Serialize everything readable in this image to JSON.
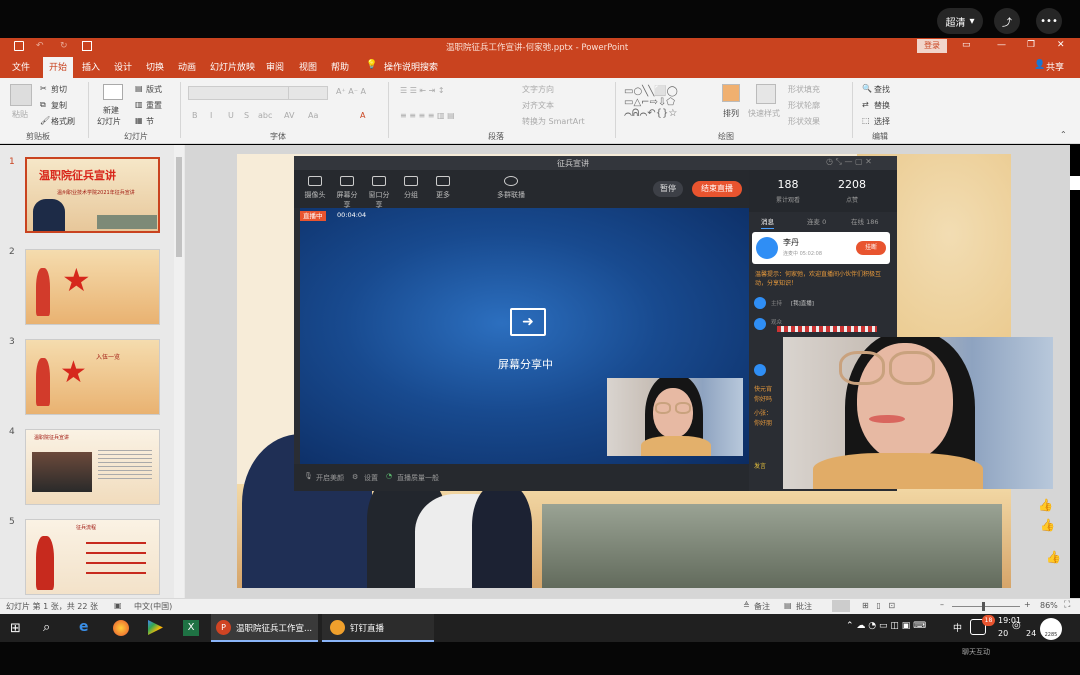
{
  "stream": {
    "quality": "超清",
    "quality_caret": "▾",
    "share": "⤴",
    "more": "•••"
  },
  "app": {
    "title": "温职院征兵工作宣讲-何家弛.pptx - PowerPoint",
    "login": "登录",
    "window_controls": [
      "▭",
      "—",
      "❐",
      "✕"
    ]
  },
  "menu": [
    "文件",
    "开始",
    "插入",
    "设计",
    "切换",
    "动画",
    "幻灯片放映",
    "审阅",
    "视图",
    "帮助"
  ],
  "menu_active_index": 1,
  "tellme": "操作说明搜索",
  "share_label": "共享",
  "ribbon": {
    "clipboard": {
      "paste": "粘贴",
      "cut": "剪切",
      "copy": "复制",
      "format": "格式刷",
      "group": "剪贴板"
    },
    "slides": {
      "new": "新建",
      "new2": "幻灯片",
      "layout": "版式",
      "reset": "重置",
      "section": "节",
      "group": "幻灯片"
    },
    "font": {
      "group": "字体",
      "buttons": [
        "B",
        "I",
        "U",
        "S",
        "abc",
        "AV",
        "Aa",
        "A"
      ]
    },
    "paragraph": {
      "group": "段落",
      "direction": "文字方向",
      "align": "对齐文本",
      "smartart": "转换为 SmartArt"
    },
    "drawing": {
      "group": "绘图",
      "arrange": "排列",
      "quickstyles": "快速样式",
      "fill": "形状填充",
      "outline": "形状轮廓",
      "effects": "形状效果"
    },
    "editing": {
      "group": "编辑",
      "find": "查找",
      "replace": "替换",
      "select": "选择"
    }
  },
  "thumbnails": [
    {
      "num": "1",
      "title": "温职院征兵宣讲",
      "subtitle": "温州职业技术学院2021年征兵宣讲"
    },
    {
      "num": "2"
    },
    {
      "num": "3",
      "title": "入伍一览"
    },
    {
      "num": "4",
      "title": "温职院征兵宣讲"
    },
    {
      "num": "5",
      "title": "征兵流程"
    }
  ],
  "status": {
    "slide_info": "幻灯片 第 1 张，共 22 张",
    "language": "中文(中国)",
    "notes": "备注",
    "comments": "批注",
    "zoom": "86%"
  },
  "meeting": {
    "title": "征兵宣讲",
    "tools": [
      "摄像头",
      "屏幕分享",
      "窗口分享",
      "分组",
      "更多"
    ],
    "invite": "多群联播",
    "pause": "暂停",
    "end": "结束直播",
    "live_badge": "直播中",
    "timer": "00:04:04",
    "sharing": "屏幕分享中",
    "foot": [
      "开启美颜",
      "设置",
      "直播质量一般"
    ],
    "stats": [
      {
        "value": "188",
        "label": "累计观看"
      },
      {
        "value": "2208",
        "label": "点赞"
      }
    ],
    "tabs": [
      "消息",
      "连麦 0",
      "在线 186"
    ],
    "host": {
      "name": "李丹",
      "status": "连麦中 05:02:08",
      "button": "挂断"
    },
    "notice": "温馨提示：何家弛，欢迎直播间小伙伴们积极互动，分享知识！",
    "msgs": [
      {
        "name": "主持",
        "text": "[我]直播]"
      },
      {
        "name": "观众",
        "text": "🟥🟥🟥🟥🟥🟥🟥🟥🟥🟥"
      }
    ],
    "side_msgs": [
      "快元宵",
      "你好吗",
      "小张：",
      "你好朋"
    ],
    "side_input": "发言"
  },
  "taskbar": {
    "apps": [
      {
        "label": "温职院征兵工作宣..."
      },
      {
        "label": "钉钉直播"
      }
    ],
    "ime": "中",
    "time": "19:01",
    "date": "20",
    "date2": "24",
    "badge": "18",
    "avatar_num": "2285"
  },
  "watermark": "聊天互动",
  "colors": {
    "accent": "#c9431f",
    "live": "#e8542f",
    "taskbar": "#202020"
  }
}
